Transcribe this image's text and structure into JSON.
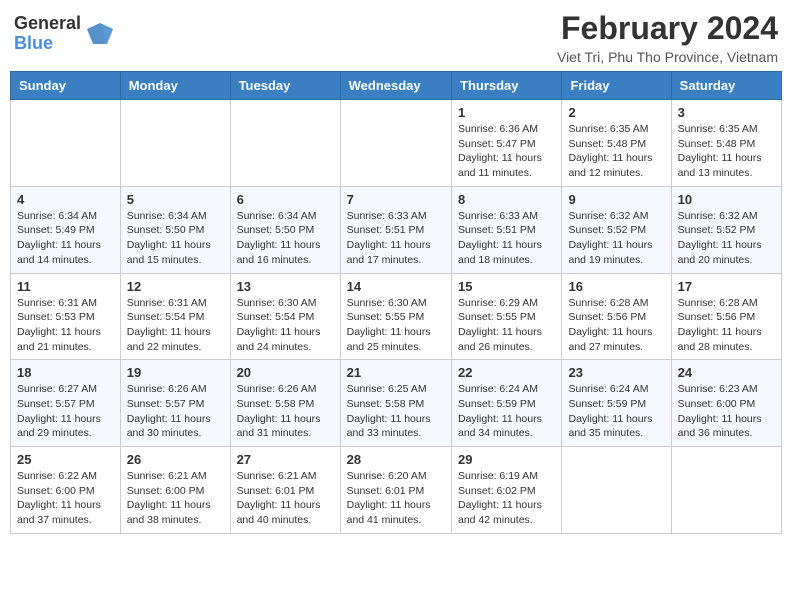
{
  "header": {
    "logo_general": "General",
    "logo_blue": "Blue",
    "title": "February 2024",
    "subtitle": "Viet Tri, Phu Tho Province, Vietnam"
  },
  "days_of_week": [
    "Sunday",
    "Monday",
    "Tuesday",
    "Wednesday",
    "Thursday",
    "Friday",
    "Saturday"
  ],
  "weeks": [
    [
      {
        "day": "",
        "info": ""
      },
      {
        "day": "",
        "info": ""
      },
      {
        "day": "",
        "info": ""
      },
      {
        "day": "",
        "info": ""
      },
      {
        "day": "1",
        "info": "Sunrise: 6:36 AM\nSunset: 5:47 PM\nDaylight: 11 hours and 11 minutes."
      },
      {
        "day": "2",
        "info": "Sunrise: 6:35 AM\nSunset: 5:48 PM\nDaylight: 11 hours and 12 minutes."
      },
      {
        "day": "3",
        "info": "Sunrise: 6:35 AM\nSunset: 5:48 PM\nDaylight: 11 hours and 13 minutes."
      }
    ],
    [
      {
        "day": "4",
        "info": "Sunrise: 6:34 AM\nSunset: 5:49 PM\nDaylight: 11 hours and 14 minutes."
      },
      {
        "day": "5",
        "info": "Sunrise: 6:34 AM\nSunset: 5:50 PM\nDaylight: 11 hours and 15 minutes."
      },
      {
        "day": "6",
        "info": "Sunrise: 6:34 AM\nSunset: 5:50 PM\nDaylight: 11 hours and 16 minutes."
      },
      {
        "day": "7",
        "info": "Sunrise: 6:33 AM\nSunset: 5:51 PM\nDaylight: 11 hours and 17 minutes."
      },
      {
        "day": "8",
        "info": "Sunrise: 6:33 AM\nSunset: 5:51 PM\nDaylight: 11 hours and 18 minutes."
      },
      {
        "day": "9",
        "info": "Sunrise: 6:32 AM\nSunset: 5:52 PM\nDaylight: 11 hours and 19 minutes."
      },
      {
        "day": "10",
        "info": "Sunrise: 6:32 AM\nSunset: 5:52 PM\nDaylight: 11 hours and 20 minutes."
      }
    ],
    [
      {
        "day": "11",
        "info": "Sunrise: 6:31 AM\nSunset: 5:53 PM\nDaylight: 11 hours and 21 minutes."
      },
      {
        "day": "12",
        "info": "Sunrise: 6:31 AM\nSunset: 5:54 PM\nDaylight: 11 hours and 22 minutes."
      },
      {
        "day": "13",
        "info": "Sunrise: 6:30 AM\nSunset: 5:54 PM\nDaylight: 11 hours and 24 minutes."
      },
      {
        "day": "14",
        "info": "Sunrise: 6:30 AM\nSunset: 5:55 PM\nDaylight: 11 hours and 25 minutes."
      },
      {
        "day": "15",
        "info": "Sunrise: 6:29 AM\nSunset: 5:55 PM\nDaylight: 11 hours and 26 minutes."
      },
      {
        "day": "16",
        "info": "Sunrise: 6:28 AM\nSunset: 5:56 PM\nDaylight: 11 hours and 27 minutes."
      },
      {
        "day": "17",
        "info": "Sunrise: 6:28 AM\nSunset: 5:56 PM\nDaylight: 11 hours and 28 minutes."
      }
    ],
    [
      {
        "day": "18",
        "info": "Sunrise: 6:27 AM\nSunset: 5:57 PM\nDaylight: 11 hours and 29 minutes."
      },
      {
        "day": "19",
        "info": "Sunrise: 6:26 AM\nSunset: 5:57 PM\nDaylight: 11 hours and 30 minutes."
      },
      {
        "day": "20",
        "info": "Sunrise: 6:26 AM\nSunset: 5:58 PM\nDaylight: 11 hours and 31 minutes."
      },
      {
        "day": "21",
        "info": "Sunrise: 6:25 AM\nSunset: 5:58 PM\nDaylight: 11 hours and 33 minutes."
      },
      {
        "day": "22",
        "info": "Sunrise: 6:24 AM\nSunset: 5:59 PM\nDaylight: 11 hours and 34 minutes."
      },
      {
        "day": "23",
        "info": "Sunrise: 6:24 AM\nSunset: 5:59 PM\nDaylight: 11 hours and 35 minutes."
      },
      {
        "day": "24",
        "info": "Sunrise: 6:23 AM\nSunset: 6:00 PM\nDaylight: 11 hours and 36 minutes."
      }
    ],
    [
      {
        "day": "25",
        "info": "Sunrise: 6:22 AM\nSunset: 6:00 PM\nDaylight: 11 hours and 37 minutes."
      },
      {
        "day": "26",
        "info": "Sunrise: 6:21 AM\nSunset: 6:00 PM\nDaylight: 11 hours and 38 minutes."
      },
      {
        "day": "27",
        "info": "Sunrise: 6:21 AM\nSunset: 6:01 PM\nDaylight: 11 hours and 40 minutes."
      },
      {
        "day": "28",
        "info": "Sunrise: 6:20 AM\nSunset: 6:01 PM\nDaylight: 11 hours and 41 minutes."
      },
      {
        "day": "29",
        "info": "Sunrise: 6:19 AM\nSunset: 6:02 PM\nDaylight: 11 hours and 42 minutes."
      },
      {
        "day": "",
        "info": ""
      },
      {
        "day": "",
        "info": ""
      }
    ]
  ]
}
